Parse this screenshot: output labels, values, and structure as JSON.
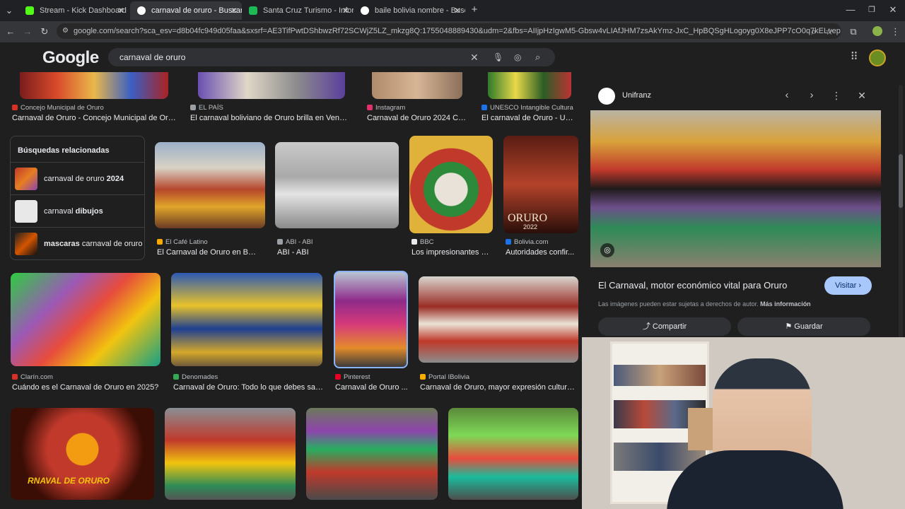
{
  "browser": {
    "tabs": [
      {
        "title": "Stream - Kick Dashboard",
        "active": false,
        "color": "#53fc18"
      },
      {
        "title": "carnaval de oruro - Buscar con",
        "active": true,
        "color": "#4285f4"
      },
      {
        "title": "Santa Cruz Turismo - Informaci",
        "active": false,
        "color": "#1db954"
      },
      {
        "title": "baile bolivia nombre - Buscar c",
        "active": false,
        "color": "#4285f4"
      }
    ],
    "url": "google.com/search?sca_esv=d8b04fc949d05faa&sxsrf=AE3TifPwtDShbwzRf72SCWjZ5LZ_mkzg8Q:1755048889430&udm=2&fbs=AIIjpHzIgwM5-Gbsw4vLIAfJHM7zsAkYmz-JxC_HpBQSgHLogoyg0X8eJPP7cO0q7kELvep1ZEg_7Y2qy0Cku24Yx-ZiP0LLxo..."
  },
  "google": {
    "logo": "Google",
    "query": "carnaval de oruro"
  },
  "results_row0": [
    {
      "source": "Concejo Municipal de Oruro",
      "caption": "Carnaval de Oruro - Concejo Municipal de Oruro",
      "fav": "#d93025"
    },
    {
      "source": "EL PAÍS",
      "caption": "El carnaval boliviano de Oruro brilla en Veneci...",
      "fav": "#9aa0a6"
    },
    {
      "source": "Instagram",
      "caption": "Carnaval de Oruro 2024 Ca...",
      "fav": "#e1306c"
    },
    {
      "source": "UNESCO Intangible Cultura...",
      "caption": "El carnaval de Oruro - UN...",
      "fav": "#1a73e8"
    }
  ],
  "related": {
    "title": "Búsquedas relacionadas",
    "items": [
      {
        "pre": "carnaval de oruro ",
        "bold": "2024",
        "post": ""
      },
      {
        "pre": "carnaval ",
        "bold": "dibujos",
        "post": ""
      },
      {
        "pre": "",
        "bold": "mascaras",
        "post": " carnaval de oruro"
      }
    ]
  },
  "results_row1": [
    {
      "source": "El Café Latino",
      "caption": "El Carnaval de Oruro en Boli...",
      "fav": "#f9ab00"
    },
    {
      "source": "ABI - ABI",
      "caption": "ABI - ABI",
      "fav": "#9aa0a6"
    },
    {
      "source": "BBC",
      "caption": "Los impresionantes c...",
      "fav": "#e8eaed"
    },
    {
      "source": "Bolivia.com",
      "caption": "Autoridades confir...",
      "fav": "#1a73e8"
    }
  ],
  "results_row2": [
    {
      "source": "Clarín.com",
      "caption": "Cuándo es el Carnaval de Oruro en 2025?",
      "fav": "#d93025"
    },
    {
      "source": "Denomades",
      "caption": "Carnaval de Oruro: Todo lo que debes saber",
      "fav": "#34a853"
    },
    {
      "source": "Pinterest",
      "caption": "Carnaval de Oruro ...",
      "fav": "#e60023"
    },
    {
      "source": "Portal IBolivia",
      "caption": "Carnaval de Oruro, mayor expresión cultural...",
      "fav": "#f9ab00"
    }
  ],
  "poster_text": "ORURO",
  "poster_year": "2022",
  "poster2_text": "RNAVAL DE ORURO",
  "panel": {
    "site": "Unifranz",
    "title": "El Carnaval, motor económico vital para Oruro",
    "visit": "Visitar",
    "rights": "Las imágenes pueden estar sujetas a derechos de autor.",
    "more_info": "Más información",
    "share": "Compartir",
    "save": "Guardar"
  }
}
